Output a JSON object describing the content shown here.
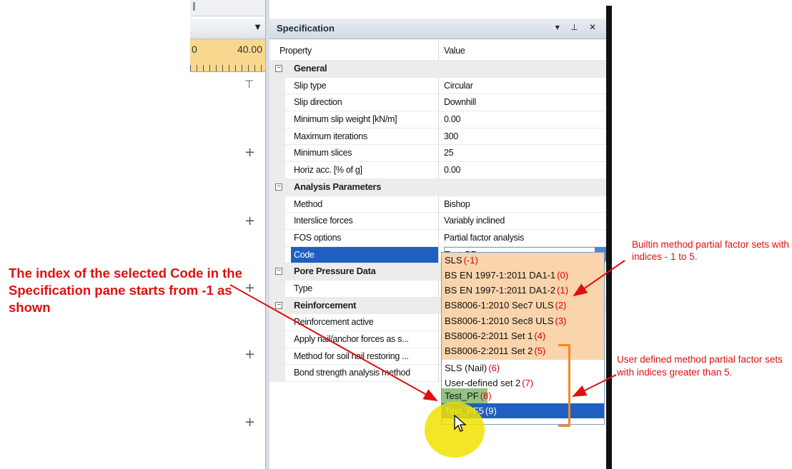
{
  "ruler": {
    "left_label": "0",
    "right_label": "40.00"
  },
  "spec_pane": {
    "title": "Specification",
    "controls": "▾ ⊥ ✕",
    "header": {
      "property": "Property",
      "value": "Value"
    },
    "rows": [
      {
        "kind": "cat",
        "name": "General"
      },
      {
        "kind": "prop",
        "name": "Slip type",
        "value": "Circular"
      },
      {
        "kind": "prop",
        "name": "Slip direction",
        "value": "Downhill"
      },
      {
        "kind": "prop",
        "name": "Minimum slip weight [kN/m]",
        "value": "0.00"
      },
      {
        "kind": "prop",
        "name": "Maximum iterations",
        "value": "300"
      },
      {
        "kind": "prop",
        "name": "Minimum slices",
        "value": "25"
      },
      {
        "kind": "prop",
        "name": "Horiz acc. [% of g]",
        "value": "0.00"
      },
      {
        "kind": "cat",
        "name": "Analysis Parameters"
      },
      {
        "kind": "prop",
        "name": "Method",
        "value": "Bishop"
      },
      {
        "kind": "prop",
        "name": "Interslice forces",
        "value": "Variably inclined"
      },
      {
        "kind": "prop",
        "name": "FOS options",
        "value": "Partial factor analysis"
      },
      {
        "kind": "sel",
        "name": "Code",
        "value": "Test_PF"
      },
      {
        "kind": "cat",
        "name": "Pore Pressure Data"
      },
      {
        "kind": "prop",
        "name": "Type",
        "value": ""
      },
      {
        "kind": "cat",
        "name": "Reinforcement"
      },
      {
        "kind": "prop",
        "name": "Reinforcement active",
        "value": ""
      },
      {
        "kind": "prop",
        "name": "Apply nail/anchor forces as s...",
        "value": ""
      },
      {
        "kind": "prop",
        "name": "Method for soil nail restoring ...",
        "value": ""
      },
      {
        "kind": "prop",
        "name": "Bond strength analysis method",
        "value": ""
      }
    ]
  },
  "dropdown": {
    "options": [
      {
        "label": "SLS",
        "index": "(-1)"
      },
      {
        "label": "BS EN 1997-1:2011 DA1-1",
        "index": "(0)"
      },
      {
        "label": "BS EN 1997-1:2011 DA1-2",
        "index": "(1)"
      },
      {
        "label": "BS8006-1:2010 Sec7 ULS",
        "index": "(2)"
      },
      {
        "label": "BS8006-1:2010 Sec8 ULS",
        "index": "(3)"
      },
      {
        "label": "BS8006-2:2011 Set 1",
        "index": "(4)"
      },
      {
        "label": "BS8006-2:2011 Set 2",
        "index": "(5)"
      },
      {
        "label": "SLS (Nail)",
        "index": "(6)"
      },
      {
        "label": "User-defined set 2",
        "index": "(7)"
      },
      {
        "label": "Test_PF",
        "index": "(8)"
      },
      {
        "label": "Test_PF5",
        "index": "(9)"
      }
    ]
  },
  "annotations": {
    "left": "The index of the selected Code in the Specification pane starts from -1 as shown",
    "builtin": "Builtin method partial factor sets with indices - 1 to 5.",
    "user": "User defined method partial factor sets with indices greater than 5."
  },
  "colors": {
    "annotation_red": "#e01010",
    "bracket_orange": "#f28a1e",
    "selection_blue": "#1f5fbf",
    "builtin_fill": "#f8cc9e"
  }
}
